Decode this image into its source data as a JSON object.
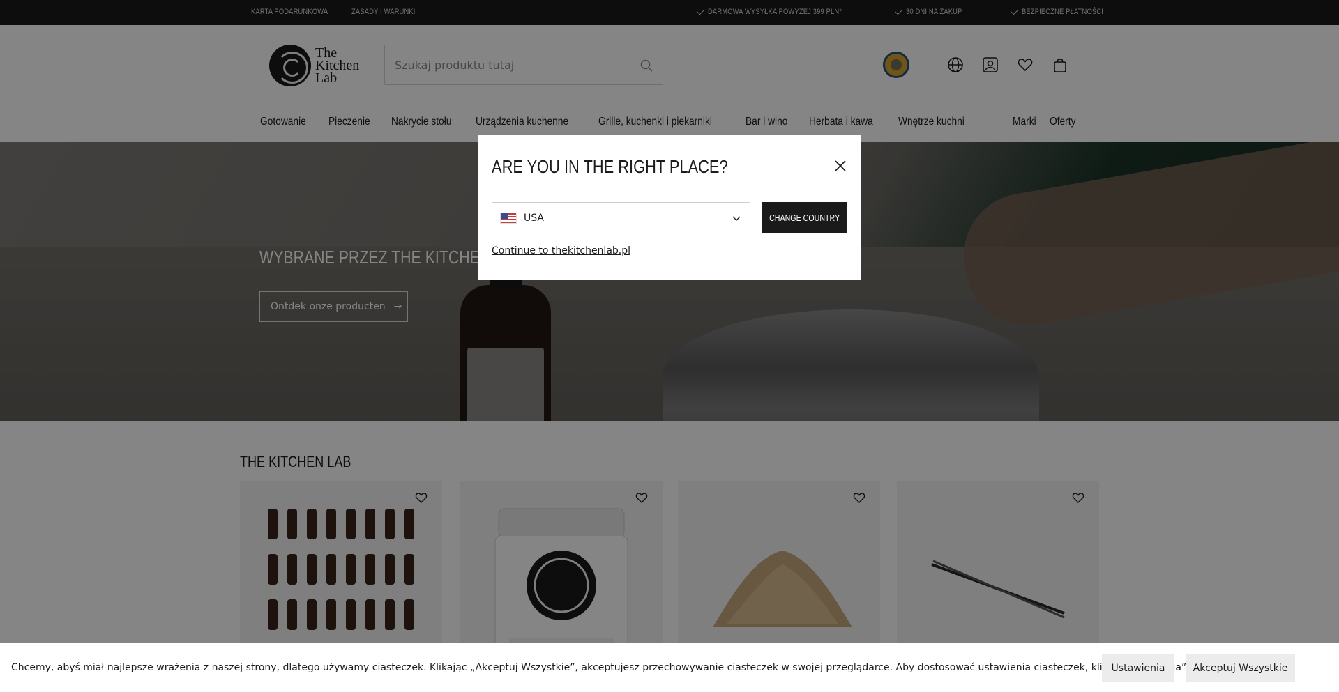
{
  "topbar": {
    "links": [
      "KARTA PODARUNKOWA",
      "ZASADY I WARUNKI"
    ],
    "usps": [
      "DARMOWA WYSYŁKA POWYŻEJ 399 PLN*",
      "30 DNI NA ZAKUP",
      "BEZPIECZNE PŁATNOŚCI"
    ]
  },
  "header": {
    "logo_text": [
      "The",
      "Kitchen",
      "Lab"
    ],
    "search_placeholder": "Szukaj produktu tutaj",
    "icons": [
      "globe-icon",
      "account-icon",
      "heart-icon",
      "bag-icon"
    ]
  },
  "nav": {
    "items": [
      "Gotowanie",
      "Pieczenie",
      "Nakrycie stołu",
      "Urządzenia kuchenne",
      "Grille, kuchenki i piekarniki",
      "Bar i wino",
      "Herbata i kawa",
      "Wnętrze kuchni"
    ],
    "right": [
      "Marki",
      "Oferty"
    ]
  },
  "hero": {
    "title": "WYBRANE PRZEZ THE KITCHEN LAB",
    "cta": "Ontdek onze producten"
  },
  "products": {
    "section_title": "THE KITCHEN LAB",
    "cards": [
      {
        "image": "flavor-drops-set"
      },
      {
        "image": "easy-binder-jar"
      },
      {
        "image": "wood-chips-pile"
      },
      {
        "image": "tweezers"
      }
    ]
  },
  "modal": {
    "title": "ARE YOU IN THE RIGHT PLACE?",
    "selected_country": "USA",
    "change_button": "CHANGE COUNTRY",
    "continue_link": "Continue to thekitchenlab.pl"
  },
  "cookie": {
    "text": "Chcemy, abyś miał najlepsze wrażenia z naszej strony, dlatego używamy ciasteczek. Klikając „Akceptuj Wszystkie”, akceptujesz przechowywanie ciasteczek w swojej przeglądarce. Aby dostosować ustawienia ciasteczek, kliknij „Ustawienia”.",
    "settings_button": "Ustawienia",
    "accept_button": "Akceptuj Wszystkie"
  }
}
